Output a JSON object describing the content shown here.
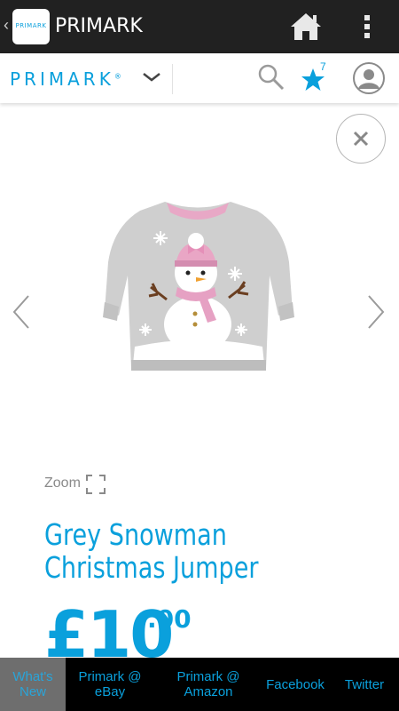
{
  "app_bar": {
    "back_glyph": "‹",
    "logo_text": "PRIMARK",
    "title": "PRIMARK",
    "home_icon": "home-icon",
    "menu_icon": "more-vert-icon"
  },
  "site_header": {
    "brand": "PRIMARK",
    "brand_mark": "®",
    "wishlist_count": "7"
  },
  "product": {
    "zoom_label": "Zoom",
    "title": "Grey Snowman Christmas Jumper",
    "price_main": "£10",
    "price_decimal": ".00"
  },
  "bottom_nav": {
    "items": [
      {
        "label": "What's New"
      },
      {
        "label": "Primark @ eBay"
      },
      {
        "label": "Primark @ Amazon"
      },
      {
        "label": "Facebook"
      },
      {
        "label": "Twitter"
      }
    ]
  },
  "colors": {
    "accent": "#0aa0dc",
    "appbar": "#212121",
    "nav_bg": "#000000",
    "nav_active": "#6e6e6e"
  }
}
